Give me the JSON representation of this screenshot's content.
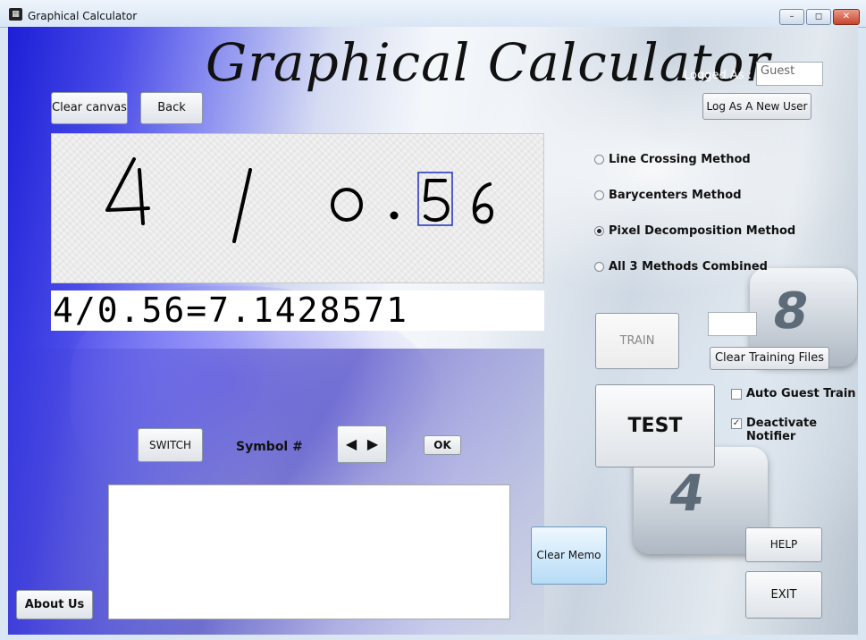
{
  "window": {
    "title": "Graphical Calculator",
    "min_label": "–",
    "max_label": "◻",
    "close_label": "✕"
  },
  "app_title": "Graphical Calculator",
  "login": {
    "label": "Logged As :",
    "username": "Guest",
    "new_user_button": "Log As A New User"
  },
  "toolbar": {
    "clear_canvas": "Clear canvas",
    "back": "Back"
  },
  "canvas": {
    "recognized_symbols": [
      "4",
      "/",
      "0",
      ".",
      "5",
      "6"
    ],
    "selected_symbol": "5"
  },
  "result": "4/0.56=7.1428571",
  "methods": [
    {
      "label": "Line Crossing Method",
      "selected": false
    },
    {
      "label": "Barycenters Method",
      "selected": false
    },
    {
      "label": "Pixel Decomposition Method",
      "selected": true
    },
    {
      "label": "All 3 Methods Combined",
      "selected": false
    }
  ],
  "train": {
    "button": "TRAIN",
    "input_value": "",
    "clear_files_button": "Clear Training Files"
  },
  "test_button": "TEST",
  "options": {
    "auto_guest_train": {
      "label": "Auto Guest Train",
      "checked": false
    },
    "deactivate_notifier": {
      "label": "Deactivate Notifier",
      "checked": true
    }
  },
  "symbol_nav": {
    "switch_button": "SWITCH",
    "label": "Symbol #",
    "prev": "◀",
    "next": "▶",
    "ok_button": "OK"
  },
  "memo": {
    "text": "",
    "clear_button": "Clear Memo"
  },
  "help_button": "HELP",
  "exit_button": "EXIT",
  "about_button": "About Us",
  "background_keys": [
    "8",
    "4"
  ]
}
